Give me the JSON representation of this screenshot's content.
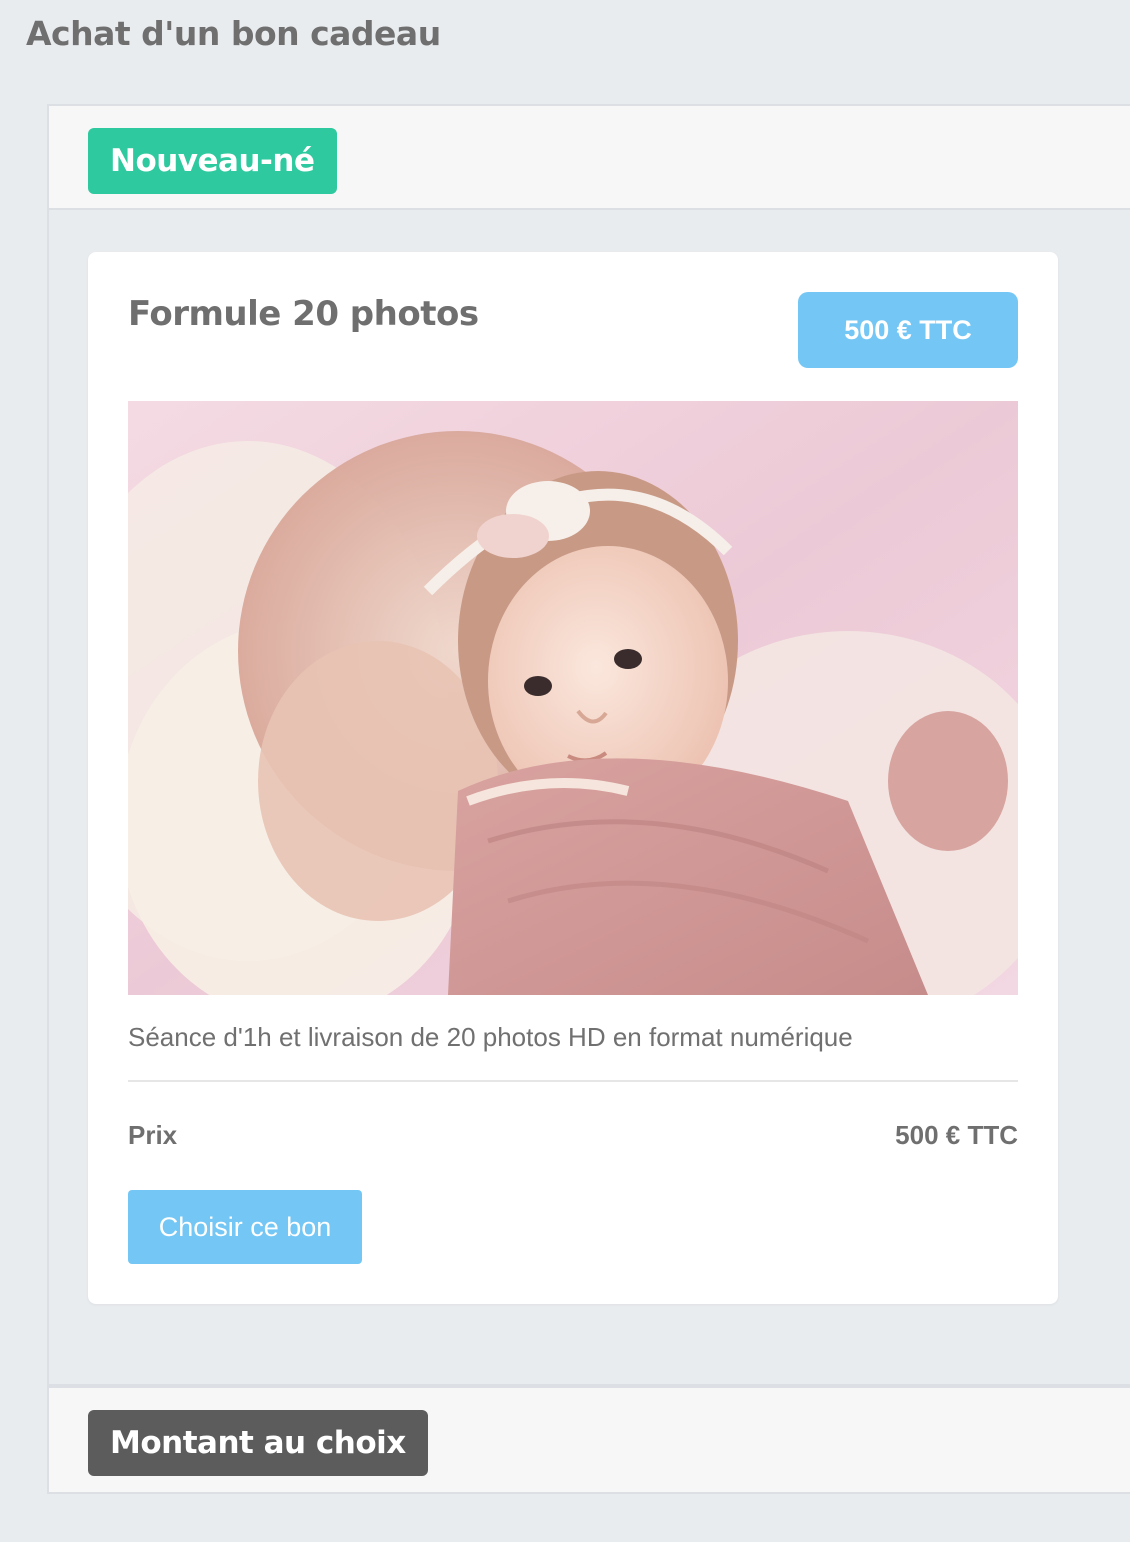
{
  "page": {
    "title": "Achat d'un bon cadeau"
  },
  "categories": [
    {
      "label": "Nouveau-né",
      "color": "#2ec99e",
      "vouchers": [
        {
          "title": "Formule 20 photos",
          "price_badge": "500 € TTC",
          "description": "Séance d'1h et livraison de 20 photos HD en format numérique",
          "price_label": "Prix",
          "price_value": "500 € TTC",
          "button_label": "Choisir ce bon",
          "image_icon": "newborn-photo"
        }
      ]
    },
    {
      "label": "Montant au choix",
      "color": "#5c5c5c"
    }
  ],
  "colors": {
    "background": "#e9ecef",
    "accent_blue": "#74c7f5",
    "accent_green": "#2ec99e",
    "text_gray": "#6f6f6f"
  }
}
